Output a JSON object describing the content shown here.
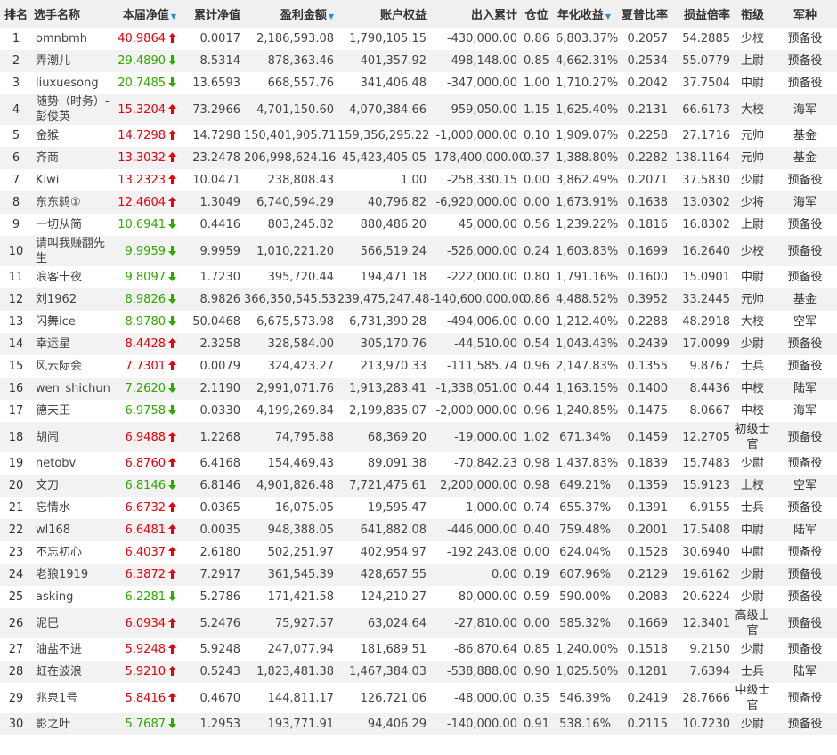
{
  "headers": [
    {
      "label": "排名",
      "sortable": false
    },
    {
      "label": "选手名称",
      "sortable": false
    },
    {
      "label": "本届净值",
      "sortable": true
    },
    {
      "label": "累计净值",
      "sortable": false
    },
    {
      "label": "盈利金额",
      "sortable": true
    },
    {
      "label": "账户权益",
      "sortable": false
    },
    {
      "label": "出入累计",
      "sortable": false
    },
    {
      "label": "仓位",
      "sortable": false
    },
    {
      "label": "年化收益",
      "sortable": true
    },
    {
      "label": "夏普比率",
      "sortable": false
    },
    {
      "label": "损益倍率",
      "sortable": false
    },
    {
      "label": "衔级",
      "sortable": false
    },
    {
      "label": "军种",
      "sortable": false
    }
  ],
  "sort_indicator": "▼",
  "colors": {
    "up": "#e8000b",
    "down": "#2fa800",
    "header_bg": "#f0f0f0",
    "stripe": "#f2f2f2",
    "sort_icon": "#2b8ad9"
  },
  "rows": [
    {
      "rank": "1",
      "name": "omnbmh",
      "nav": "40.9864",
      "dir": "up",
      "cum": "0.0017",
      "profit": "2,186,593.08",
      "equity": "1,790,105.15",
      "flow": "-430,000.00",
      "pos": "0.86",
      "annual": "6,803.37%",
      "sharpe": "0.2057",
      "ratio": "54.2885",
      "grade": "少校",
      "branch": "预备役",
      "tall": false
    },
    {
      "rank": "2",
      "name": "弄潮儿",
      "nav": "29.4890",
      "dir": "down",
      "cum": "8.5314",
      "profit": "878,363.46",
      "equity": "401,357.92",
      "flow": "-498,148.00",
      "pos": "0.85",
      "annual": "4,662.31%",
      "sharpe": "0.2534",
      "ratio": "55.0779",
      "grade": "上尉",
      "branch": "预备役",
      "tall": false
    },
    {
      "rank": "3",
      "name": "liuxuesong",
      "nav": "20.7485",
      "dir": "down",
      "cum": "13.6593",
      "profit": "668,557.76",
      "equity": "341,406.48",
      "flow": "-347,000.00",
      "pos": "1.00",
      "annual": "1,710.27%",
      "sharpe": "0.2042",
      "ratio": "37.7504",
      "grade": "中尉",
      "branch": "预备役",
      "tall": false
    },
    {
      "rank": "4",
      "name": "随势（时务）-彭俊英",
      "nav": "15.3204",
      "dir": "up",
      "cum": "73.2966",
      "profit": "4,701,150.60",
      "equity": "4,070,384.66",
      "flow": "-959,050.00",
      "pos": "1.15",
      "annual": "1,625.40%",
      "sharpe": "0.2131",
      "ratio": "66.6173",
      "grade": "大校",
      "branch": "海军",
      "tall": true
    },
    {
      "rank": "5",
      "name": "金猴",
      "nav": "14.7298",
      "dir": "up",
      "cum": "14.7298",
      "profit": "150,401,905.71",
      "equity": "159,356,295.22",
      "flow": "-1,000,000.00",
      "pos": "0.10",
      "annual": "1,909.07%",
      "sharpe": "0.2258",
      "ratio": "27.1716",
      "grade": "元帅",
      "branch": "基金",
      "tall": false
    },
    {
      "rank": "6",
      "name": "齐商",
      "nav": "13.3032",
      "dir": "up",
      "cum": "23.2478",
      "profit": "206,998,624.16",
      "equity": "45,423,405.05",
      "flow": "-178,400,000.00",
      "pos": "0.37",
      "annual": "1,388.80%",
      "sharpe": "0.2282",
      "ratio": "138.1164",
      "grade": "元帅",
      "branch": "基金",
      "tall": false
    },
    {
      "rank": "7",
      "name": "Kiwi",
      "nav": "13.2323",
      "dir": "up",
      "cum": "10.0471",
      "profit": "238,808.43",
      "equity": "1.00",
      "flow": "-258,330.15",
      "pos": "0.00",
      "annual": "3,862.49%",
      "sharpe": "0.2071",
      "ratio": "37.5830",
      "grade": "少尉",
      "branch": "预备役",
      "tall": false
    },
    {
      "rank": "8",
      "name": "东东鸫①",
      "nav": "12.4604",
      "dir": "up",
      "cum": "1.3049",
      "profit": "6,740,594.29",
      "equity": "40,796.82",
      "flow": "-6,920,000.00",
      "pos": "0.00",
      "annual": "1,673.91%",
      "sharpe": "0.1638",
      "ratio": "13.0302",
      "grade": "少将",
      "branch": "海军",
      "tall": false
    },
    {
      "rank": "9",
      "name": "一切从简",
      "nav": "10.6941",
      "dir": "down",
      "cum": "0.4416",
      "profit": "803,245.82",
      "equity": "880,486.20",
      "flow": "45,000.00",
      "pos": "0.56",
      "annual": "1,239.22%",
      "sharpe": "0.1816",
      "ratio": "16.8302",
      "grade": "上尉",
      "branch": "预备役",
      "tall": false
    },
    {
      "rank": "10",
      "name": "请叫我赚翻先生",
      "nav": "9.9959",
      "dir": "down",
      "cum": "9.9959",
      "profit": "1,010,221.20",
      "equity": "566,519.24",
      "flow": "-526,000.00",
      "pos": "0.24",
      "annual": "1,603.83%",
      "sharpe": "0.1699",
      "ratio": "16.2640",
      "grade": "少校",
      "branch": "预备役",
      "tall": true
    },
    {
      "rank": "11",
      "name": "浪客十夜",
      "nav": "9.8097",
      "dir": "down",
      "cum": "1.7230",
      "profit": "395,720.44",
      "equity": "194,471.18",
      "flow": "-222,000.00",
      "pos": "0.80",
      "annual": "1,791.16%",
      "sharpe": "0.1600",
      "ratio": "15.0901",
      "grade": "中尉",
      "branch": "预备役",
      "tall": false
    },
    {
      "rank": "12",
      "name": "刘1962",
      "nav": "8.9826",
      "dir": "down",
      "cum": "8.9826",
      "profit": "366,350,545.53",
      "equity": "239,475,247.48",
      "flow": "-140,600,000.00",
      "pos": "0.86",
      "annual": "4,488.52%",
      "sharpe": "0.3952",
      "ratio": "33.2445",
      "grade": "元帅",
      "branch": "基金",
      "tall": false
    },
    {
      "rank": "13",
      "name": "闪舞ice",
      "nav": "8.9780",
      "dir": "down",
      "cum": "50.0468",
      "profit": "6,675,573.98",
      "equity": "6,731,390.28",
      "flow": "-494,006.00",
      "pos": "0.00",
      "annual": "1,212.40%",
      "sharpe": "0.2288",
      "ratio": "48.2918",
      "grade": "大校",
      "branch": "空军",
      "tall": false
    },
    {
      "rank": "14",
      "name": "幸运星",
      "nav": "8.4428",
      "dir": "up",
      "cum": "2.3258",
      "profit": "328,584.00",
      "equity": "305,170.76",
      "flow": "-44,510.00",
      "pos": "0.54",
      "annual": "1,043.43%",
      "sharpe": "0.2439",
      "ratio": "17.0099",
      "grade": "少尉",
      "branch": "预备役",
      "tall": false
    },
    {
      "rank": "15",
      "name": "风云际会",
      "nav": "7.7301",
      "dir": "up",
      "cum": "0.0079",
      "profit": "324,423.27",
      "equity": "213,970.33",
      "flow": "-111,585.74",
      "pos": "0.96",
      "annual": "2,147.83%",
      "sharpe": "0.1355",
      "ratio": "9.8767",
      "grade": "士兵",
      "branch": "预备役",
      "tall": false
    },
    {
      "rank": "16",
      "name": "wen_shichun",
      "nav": "7.2620",
      "dir": "down",
      "cum": "2.1190",
      "profit": "2,991,071.76",
      "equity": "1,913,283.41",
      "flow": "-1,338,051.00",
      "pos": "0.44",
      "annual": "1,163.15%",
      "sharpe": "0.1400",
      "ratio": "8.4436",
      "grade": "中校",
      "branch": "陆军",
      "tall": false
    },
    {
      "rank": "17",
      "name": "德天王",
      "nav": "6.9758",
      "dir": "down",
      "cum": "0.0330",
      "profit": "4,199,269.84",
      "equity": "2,199,835.07",
      "flow": "-2,000,000.00",
      "pos": "0.96",
      "annual": "1,240.85%",
      "sharpe": "0.1475",
      "ratio": "8.0667",
      "grade": "中校",
      "branch": "海军",
      "tall": false
    },
    {
      "rank": "18",
      "name": "胡闹",
      "nav": "6.9488",
      "dir": "up",
      "cum": "1.2268",
      "profit": "74,795.88",
      "equity": "68,369.20",
      "flow": "-19,000.00",
      "pos": "1.02",
      "annual": "671.34%",
      "sharpe": "0.1459",
      "ratio": "12.2705",
      "grade": "初级士官",
      "branch": "预备役",
      "tall": true
    },
    {
      "rank": "19",
      "name": "netobv",
      "nav": "6.8760",
      "dir": "up",
      "cum": "6.4168",
      "profit": "154,469.43",
      "equity": "89,091.38",
      "flow": "-70,842.23",
      "pos": "0.98",
      "annual": "1,437.83%",
      "sharpe": "0.1839",
      "ratio": "15.7483",
      "grade": "少尉",
      "branch": "预备役",
      "tall": false
    },
    {
      "rank": "20",
      "name": "文刀",
      "nav": "6.8146",
      "dir": "down",
      "cum": "6.8146",
      "profit": "4,901,826.48",
      "equity": "7,721,475.61",
      "flow": "2,200,000.00",
      "pos": "0.98",
      "annual": "649.21%",
      "sharpe": "0.1359",
      "ratio": "15.9123",
      "grade": "上校",
      "branch": "空军",
      "tall": false
    },
    {
      "rank": "21",
      "name": "忘情水",
      "nav": "6.6732",
      "dir": "up",
      "cum": "0.0365",
      "profit": "16,075.05",
      "equity": "19,595.47",
      "flow": "1,000.00",
      "pos": "0.74",
      "annual": "655.37%",
      "sharpe": "0.1391",
      "ratio": "6.9155",
      "grade": "士兵",
      "branch": "预备役",
      "tall": false
    },
    {
      "rank": "22",
      "name": "wl168",
      "nav": "6.6481",
      "dir": "up",
      "cum": "0.0035",
      "profit": "948,388.05",
      "equity": "641,882.08",
      "flow": "-446,000.00",
      "pos": "0.40",
      "annual": "759.48%",
      "sharpe": "0.2001",
      "ratio": "17.5408",
      "grade": "中尉",
      "branch": "陆军",
      "tall": false
    },
    {
      "rank": "23",
      "name": "不忘初心",
      "nav": "6.4037",
      "dir": "up",
      "cum": "2.6180",
      "profit": "502,251.97",
      "equity": "402,954.97",
      "flow": "-192,243.08",
      "pos": "0.00",
      "annual": "624.04%",
      "sharpe": "0.1528",
      "ratio": "30.6940",
      "grade": "中尉",
      "branch": "预备役",
      "tall": false
    },
    {
      "rank": "24",
      "name": "老狼1919",
      "nav": "6.3872",
      "dir": "up",
      "cum": "7.2917",
      "profit": "361,545.39",
      "equity": "428,657.55",
      "flow": "0.00",
      "pos": "0.19",
      "annual": "607.96%",
      "sharpe": "0.2129",
      "ratio": "19.6162",
      "grade": "少尉",
      "branch": "预备役",
      "tall": false
    },
    {
      "rank": "25",
      "name": "asking",
      "nav": "6.2281",
      "dir": "down",
      "cum": "5.2786",
      "profit": "171,421.58",
      "equity": "124,210.27",
      "flow": "-80,000.00",
      "pos": "0.59",
      "annual": "590.00%",
      "sharpe": "0.2083",
      "ratio": "20.6224",
      "grade": "少尉",
      "branch": "预备役",
      "tall": false
    },
    {
      "rank": "26",
      "name": "泥巴",
      "nav": "6.0934",
      "dir": "up",
      "cum": "5.2476",
      "profit": "75,927.57",
      "equity": "63,024.64",
      "flow": "-27,810.00",
      "pos": "0.00",
      "annual": "585.32%",
      "sharpe": "0.1669",
      "ratio": "12.3401",
      "grade": "高级士官",
      "branch": "预备役",
      "tall": true
    },
    {
      "rank": "27",
      "name": "油盐不进",
      "nav": "5.9248",
      "dir": "up",
      "cum": "5.9248",
      "profit": "247,077.94",
      "equity": "181,689.51",
      "flow": "-86,870.64",
      "pos": "0.85",
      "annual": "1,240.00%",
      "sharpe": "0.1518",
      "ratio": "9.2150",
      "grade": "少尉",
      "branch": "预备役",
      "tall": false
    },
    {
      "rank": "28",
      "name": "虹在波浪",
      "nav": "5.9210",
      "dir": "up",
      "cum": "0.5243",
      "profit": "1,823,481.38",
      "equity": "1,467,384.03",
      "flow": "-538,888.00",
      "pos": "0.90",
      "annual": "1,025.50%",
      "sharpe": "0.1281",
      "ratio": "7.6394",
      "grade": "士兵",
      "branch": "陆军",
      "tall": false
    },
    {
      "rank": "29",
      "name": "兆泉1号",
      "nav": "5.8416",
      "dir": "up",
      "cum": "0.4670",
      "profit": "144,811.17",
      "equity": "126,721.06",
      "flow": "-48,000.00",
      "pos": "0.35",
      "annual": "546.39%",
      "sharpe": "0.2419",
      "ratio": "28.7666",
      "grade": "中级士官",
      "branch": "预备役",
      "tall": true
    },
    {
      "rank": "30",
      "name": "影之叶",
      "nav": "5.7687",
      "dir": "down",
      "cum": "1.2953",
      "profit": "193,771.91",
      "equity": "94,406.29",
      "flow": "-140,000.00",
      "pos": "0.91",
      "annual": "538.16%",
      "sharpe": "0.2115",
      "ratio": "10.7230",
      "grade": "少尉",
      "branch": "预备役",
      "tall": false
    }
  ]
}
